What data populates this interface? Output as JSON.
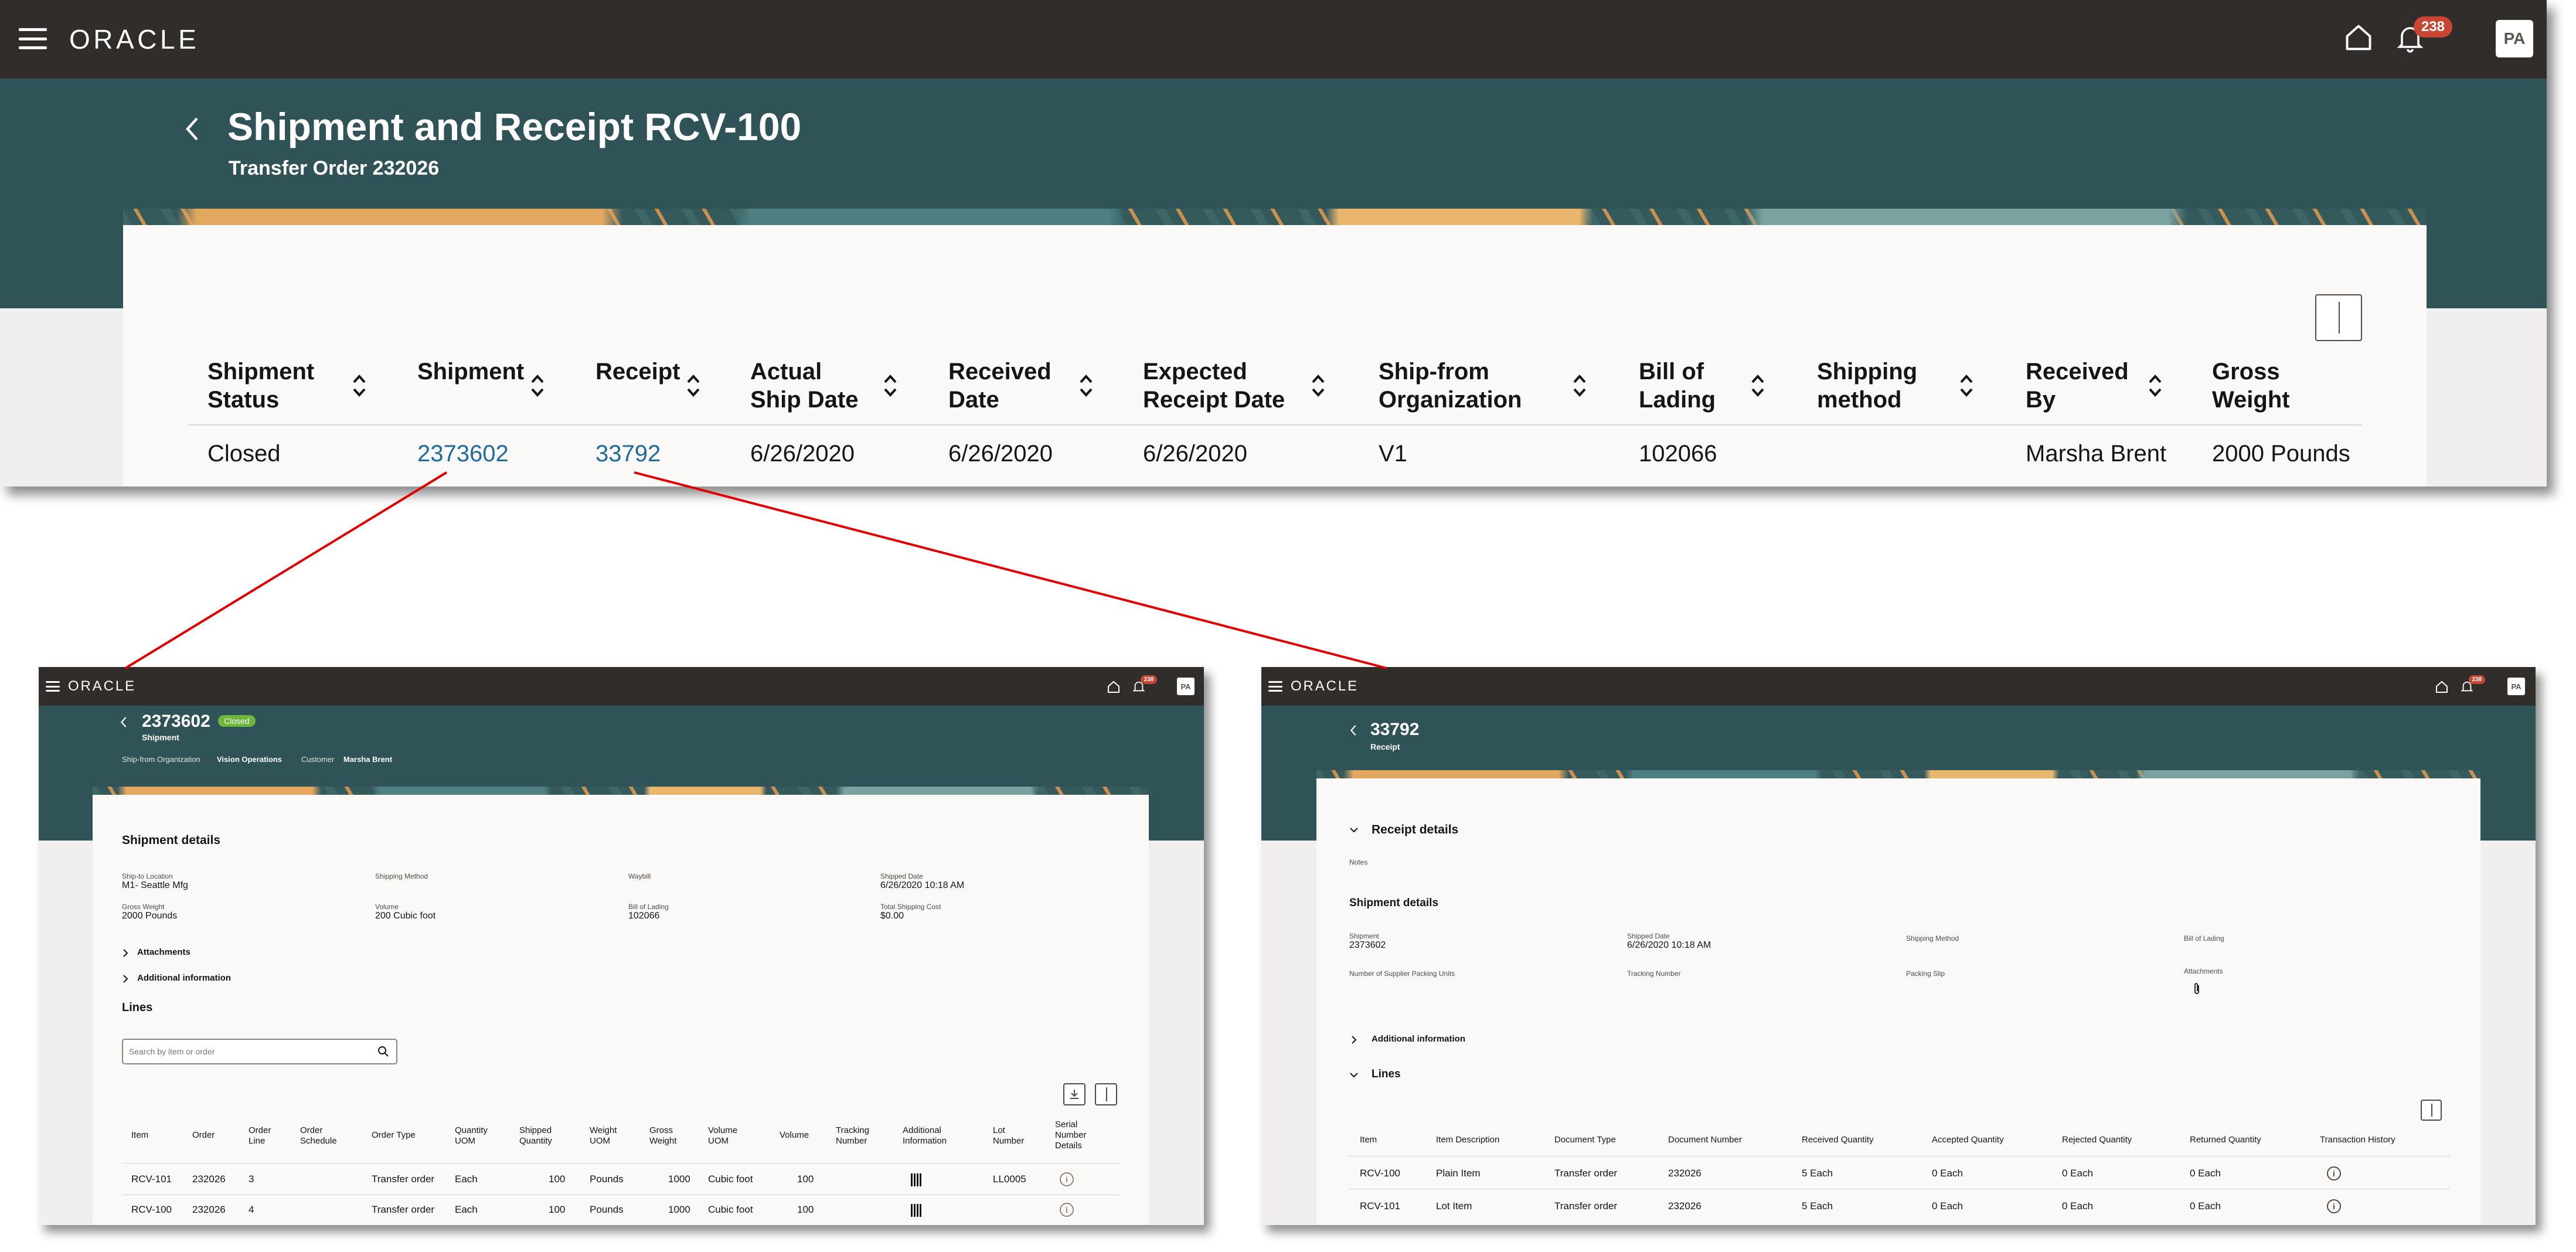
{
  "main": {
    "logo": "ORACLE",
    "notification_count": "238",
    "avatar": "PA",
    "title": "Shipment and Receipt RCV-100",
    "subtitle": "Transfer Order 232026",
    "columns": [
      {
        "label": "Shipment Status"
      },
      {
        "label": "Shipment"
      },
      {
        "label": "Receipt"
      },
      {
        "label": "Actual Ship Date"
      },
      {
        "label": "Received Date"
      },
      {
        "label": "Expected Receipt Date"
      },
      {
        "label": "Ship-from Organization"
      },
      {
        "label": "Bill of Lading"
      },
      {
        "label": "Shipping method"
      },
      {
        "label": "Received By"
      },
      {
        "label": "Gross Weight"
      }
    ],
    "row": {
      "status": "Closed",
      "shipment": "2373602",
      "receipt": "33792",
      "actual_ship_date": "6/26/2020",
      "received_date": "6/26/2020",
      "expected_receipt_date": "6/26/2020",
      "ship_from": "V1",
      "bill_of_lading": "102066",
      "shipping_method": "",
      "received_by": "Marsha Brent",
      "gross_weight": "2000 Pounds"
    }
  },
  "shipment_page": {
    "logo": "ORACLE",
    "notification_count": "238",
    "avatar": "PA",
    "title": "2373602",
    "status_badge": "Closed",
    "subtitle": "Shipment",
    "meta_shipfrom_label": "Ship-from Organization",
    "meta_shipfrom_value": "Vision Operations",
    "meta_customer_label": "Customer",
    "meta_customer_value": "Marsha Brent",
    "details_title": "Shipment details",
    "fields": {
      "ship_to_label": "Ship-to Location",
      "ship_to_value": "M1- Seattle Mfg",
      "shipping_method_label": "Shipping Method",
      "waybill_label": "Waybill",
      "shipped_date_label": "Shipped Date",
      "shipped_date_value": "6/26/2020 10:18 AM",
      "gross_weight_label": "Gross Weight",
      "gross_weight_value": "2000 Pounds",
      "volume_label": "Volume",
      "volume_value": "200 Cubic foot",
      "bol_label": "Bill of Lading",
      "bol_value": "102066",
      "total_cost_label": "Total Shipping Cost",
      "total_cost_value": "$0.00"
    },
    "attachments": "Attachments",
    "additional_info": "Additional information",
    "lines_title": "Lines",
    "search_placeholder": "Search by item or order",
    "columns": [
      "Item",
      "Order",
      "Order Line",
      "Order Schedule",
      "Order Type",
      "Quantity UOM",
      "Shipped Quantity",
      "Weight UOM",
      "Gross Weight",
      "Volume UOM",
      "Volume",
      "Tracking Number",
      "Additional Information",
      "Lot Number",
      "Serial Number Details"
    ],
    "rows": [
      {
        "item": "RCV-101",
        "order": "232026",
        "line": "3",
        "type": "Transfer order",
        "uom": "Each",
        "qty": "100",
        "wuom": "Pounds",
        "gw": "1000",
        "vuom": "Cubic foot",
        "vol": "100",
        "lot": "LL0005"
      },
      {
        "item": "RCV-100",
        "order": "232026",
        "line": "4",
        "type": "Transfer order",
        "uom": "Each",
        "qty": "100",
        "wuom": "Pounds",
        "gw": "1000",
        "vuom": "Cubic foot",
        "vol": "100",
        "lot": ""
      }
    ]
  },
  "receipt_page": {
    "logo": "ORACLE",
    "notification_count": "238",
    "avatar": "PA",
    "title": "33792",
    "subtitle": "Receipt",
    "receipt_details": "Receipt details",
    "notes_label": "Notes",
    "shipment_details": "Shipment details",
    "fields": {
      "shipment_label": "Shipment",
      "shipment_value": "2373602",
      "shipped_date_label": "Shipped Date",
      "shipped_date_value": "6/26/2020 10:18 AM",
      "shipping_method_label": "Shipping Method",
      "bol_label": "Bill of Lading",
      "packing_units_label": "Number of Supplier Packing Units",
      "tracking_label": "Tracking Number",
      "packing_slip_label": "Packing Slip",
      "attachments_label": "Attachments"
    },
    "additional_info": "Additional information",
    "lines_title": "Lines",
    "columns": [
      "Item",
      "Item Description",
      "Document Type",
      "Document Number",
      "Received Quantity",
      "Accepted Quantity",
      "Rejected Quantity",
      "Returned Quantity",
      "Transaction History"
    ],
    "rows": [
      {
        "item": "RCV-100",
        "desc": "Plain Item",
        "doctype": "Transfer order",
        "docnum": "232026",
        "received": "5 Each",
        "accepted": "0 Each",
        "rejected": "0 Each",
        "returned": "0 Each"
      },
      {
        "item": "RCV-101",
        "desc": "Lot Item",
        "doctype": "Transfer order",
        "docnum": "232026",
        "received": "5 Each",
        "accepted": "0 Each",
        "rejected": "0 Each",
        "returned": "0 Each"
      }
    ]
  },
  "colors": {
    "header": "#312d2a",
    "teal": "#2f5356",
    "link": "#1f6c9c",
    "badge": "#c74634",
    "connector": "#e00000",
    "closed_badge": "#6fb73c"
  }
}
